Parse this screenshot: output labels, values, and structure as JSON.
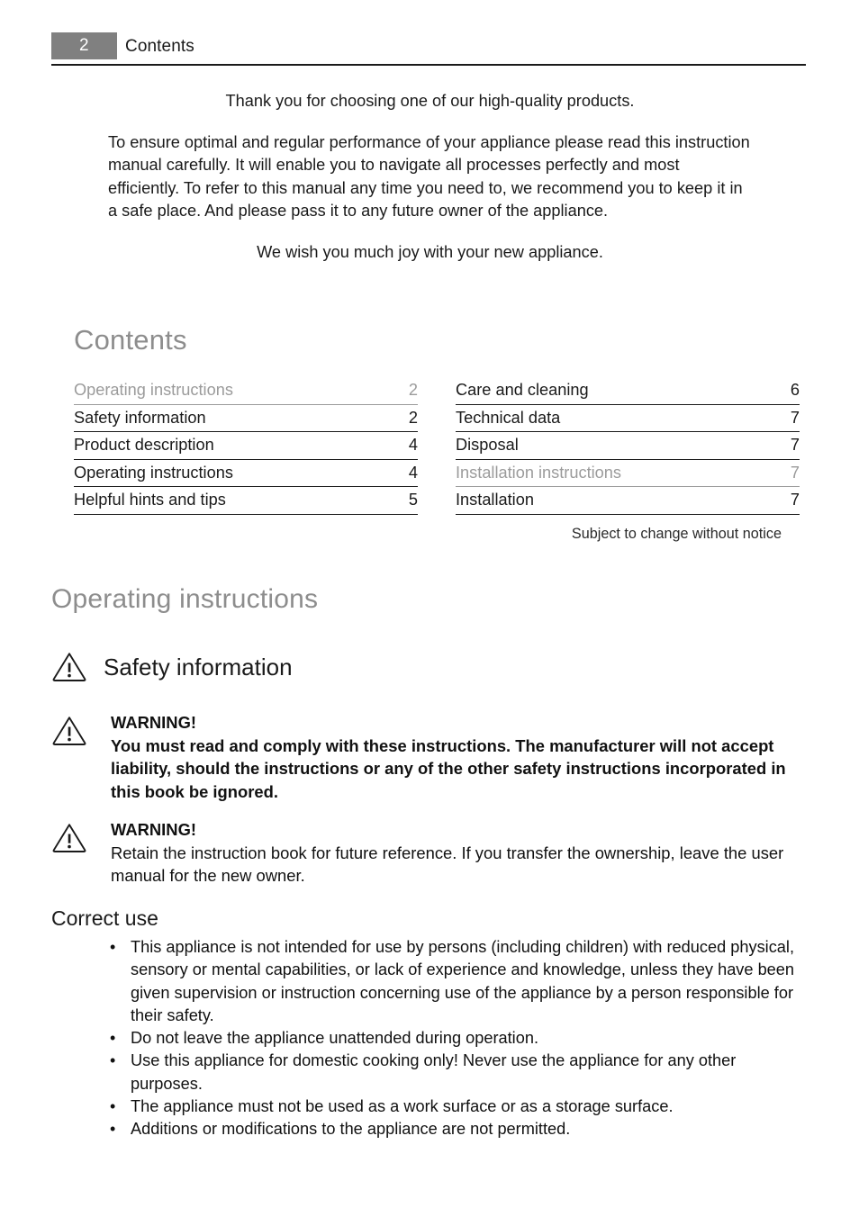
{
  "header": {
    "page_number": "2",
    "title": "Contents"
  },
  "intro": {
    "thanks": "Thank you for choosing one of our high-quality products.",
    "body": "To ensure optimal and regular performance of your appliance please read this instruction manual carefully. It will enable you to navigate all processes perfectly and most efficiently. To refer to this manual any time you need to, we recommend you to keep it in a safe place. And please pass it to any future owner of the appliance.",
    "wish": "We wish you much joy with your new appliance."
  },
  "contents": {
    "heading": "Contents",
    "left_column": [
      {
        "label": "Operating instructions",
        "page": "2",
        "section": true
      },
      {
        "label": "Safety information",
        "page": "2",
        "section": false
      },
      {
        "label": "Product description",
        "page": "4",
        "section": false
      },
      {
        "label": "Operating instructions",
        "page": "4",
        "section": false
      },
      {
        "label": "Helpful hints and tips",
        "page": "5",
        "section": false
      }
    ],
    "right_column": [
      {
        "label": "Care and cleaning",
        "page": "6",
        "section": false
      },
      {
        "label": "Technical data",
        "page": "7",
        "section": false
      },
      {
        "label": "Disposal",
        "page": "7",
        "section": false
      },
      {
        "label": "Installation instructions",
        "page": "7",
        "section": true
      },
      {
        "label": "Installation",
        "page": "7",
        "section": false
      }
    ],
    "note": "Subject to change without notice"
  },
  "operating_instructions": {
    "section_title": "Operating instructions",
    "safety_heading": "Safety information",
    "warnings": [
      {
        "title": "WARNING!",
        "text": "You must read and comply with these instructions. The manufacturer will not accept liability, should the instructions or any of the other safety instructions incorporated in this book be ignored.",
        "bold": true
      },
      {
        "title": "WARNING!",
        "text": "Retain the instruction book for future reference. If you transfer the ownership, leave the user manual for the new owner.",
        "bold": false
      }
    ],
    "correct_use": {
      "heading": "Correct use",
      "items": [
        "This appliance is not intended for use by persons (including children) with reduced physical, sensory or mental capabilities, or lack of experience and knowledge, unless they have been given supervision or instruction concerning use of the appliance by a person responsible for their safety.",
        "Do not leave the appliance unattended during operation.",
        "Use this appliance for domestic cooking only! Never use the appliance for any other purposes.",
        "The appliance must not be used as a work surface or as a storage surface.",
        "Additions or modifications to the appliance are not permitted."
      ]
    }
  },
  "icons": {
    "warning_triangle": "warning-triangle-icon"
  },
  "colors": {
    "page_number_box": "#808080",
    "section_gray": "#8d8d8d",
    "toc_section_gray": "#9b9b9b",
    "text": "#1a1a1a",
    "rule": "#1a1a1a"
  }
}
